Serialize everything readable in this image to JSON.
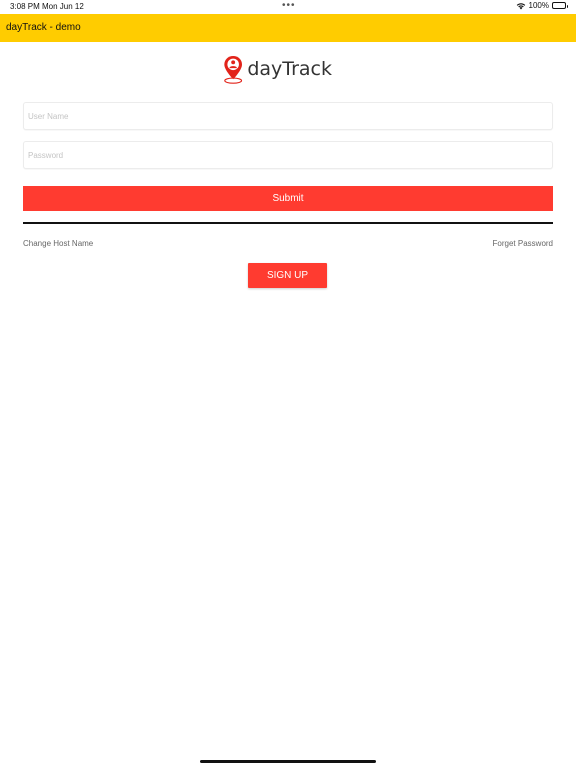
{
  "status_bar": {
    "time": "3:08 PM",
    "date": "Mon Jun 12",
    "dots": "•••",
    "battery": "100%",
    "wifi_icon": "wifi-icon",
    "battery_icon": "battery-full-icon"
  },
  "nav": {
    "title": "dayTrack - demo",
    "background": "#ffcc00"
  },
  "logo": {
    "text": "dayTrack",
    "icon": "location-pin-person-icon",
    "icon_color": "#e2231a"
  },
  "form": {
    "username_placeholder": "User Name",
    "username_value": "",
    "password_placeholder": "Password",
    "password_value": "",
    "submit_label": "Submit"
  },
  "links": {
    "change_host": "Change Host Name",
    "forget_password": "Forget Password"
  },
  "signup_label": "SIGN UP",
  "colors": {
    "accent": "#ff3b30"
  }
}
